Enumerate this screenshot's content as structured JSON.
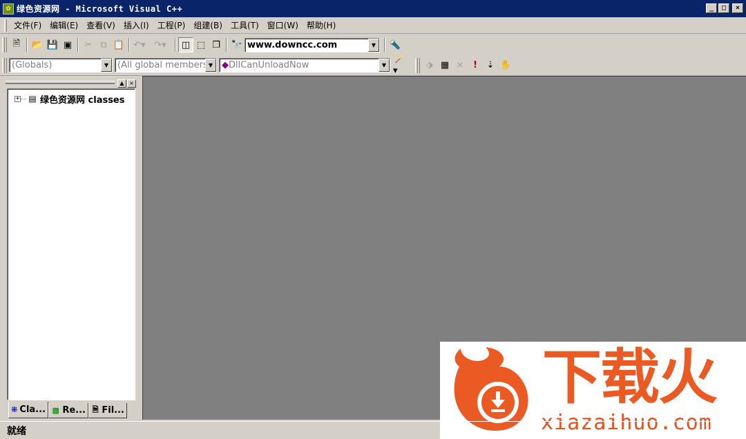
{
  "window": {
    "title": "绿色资源网 - Microsoft Visual C++",
    "app_icon": "vc-icon",
    "minimize_glyph": "_",
    "maximize_glyph": "□",
    "close_glyph": "×"
  },
  "menu": [
    {
      "label": "文件(F)"
    },
    {
      "label": "编辑(E)"
    },
    {
      "label": "查看(V)"
    },
    {
      "label": "插入(I)"
    },
    {
      "label": "工程(P)"
    },
    {
      "label": "组建(B)"
    },
    {
      "label": "工具(T)"
    },
    {
      "label": "窗口(W)"
    },
    {
      "label": "帮助(H)"
    }
  ],
  "toolbar_standard": {
    "find_combo_value": "www.downcc.com",
    "icons": [
      "new-file",
      "open",
      "save",
      "save-all",
      "cut",
      "copy",
      "paste",
      "undo",
      "redo",
      "workspace",
      "output",
      "window-list",
      "find-in-files",
      "search"
    ]
  },
  "toolbar_wizard": {
    "scope_combo": "(Globals)",
    "members_combo": "(All global members",
    "function_combo": "DllCanUnloadNow",
    "icons": [
      "wizard-action",
      "compile",
      "build",
      "stop-build",
      "execute",
      "insert-breakpoint",
      "go"
    ]
  },
  "workspace": {
    "tree_root_label": "绿色资源网 classes",
    "tabs": [
      {
        "label": "Cla...",
        "icon": "class-view-icon",
        "active": true
      },
      {
        "label": "Re...",
        "icon": "resource-view-icon",
        "active": false
      },
      {
        "label": "Fil...",
        "icon": "file-view-icon",
        "active": false
      }
    ]
  },
  "watermark": {
    "cn_text": "下载火",
    "url_text": "xiazaihuo.com",
    "color": "#ec5a24"
  },
  "status": {
    "text": "就绪"
  }
}
